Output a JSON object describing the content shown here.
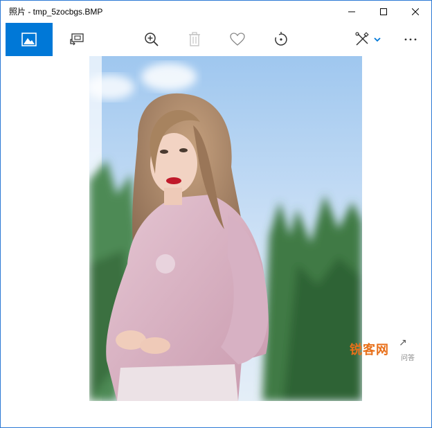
{
  "window": {
    "title": "照片 - tmp_5zocbgs.BMP"
  },
  "titlebar_buttons": [
    {
      "name": "minimize",
      "icon": "minimize-icon"
    },
    {
      "name": "maximize",
      "icon": "maximize-icon"
    },
    {
      "name": "close",
      "icon": "close-icon"
    }
  ],
  "toolbar": {
    "items": [
      {
        "name": "view-photo",
        "icon": "image-icon",
        "active": true
      },
      {
        "name": "slideshow",
        "icon": "slideshow-icon"
      },
      {
        "name": "zoom",
        "icon": "zoom-in-icon"
      },
      {
        "name": "delete",
        "icon": "trash-icon",
        "disabled": true
      },
      {
        "name": "favorite",
        "icon": "heart-icon"
      },
      {
        "name": "rotate",
        "icon": "rotate-icon"
      },
      {
        "name": "edit-create",
        "icon": "edit-create-icon"
      },
      {
        "name": "more",
        "icon": "more-icon"
      }
    ],
    "accent_color": "#0078d7"
  },
  "watermark": {
    "text": "锐客网",
    "sub_text": "问答"
  }
}
